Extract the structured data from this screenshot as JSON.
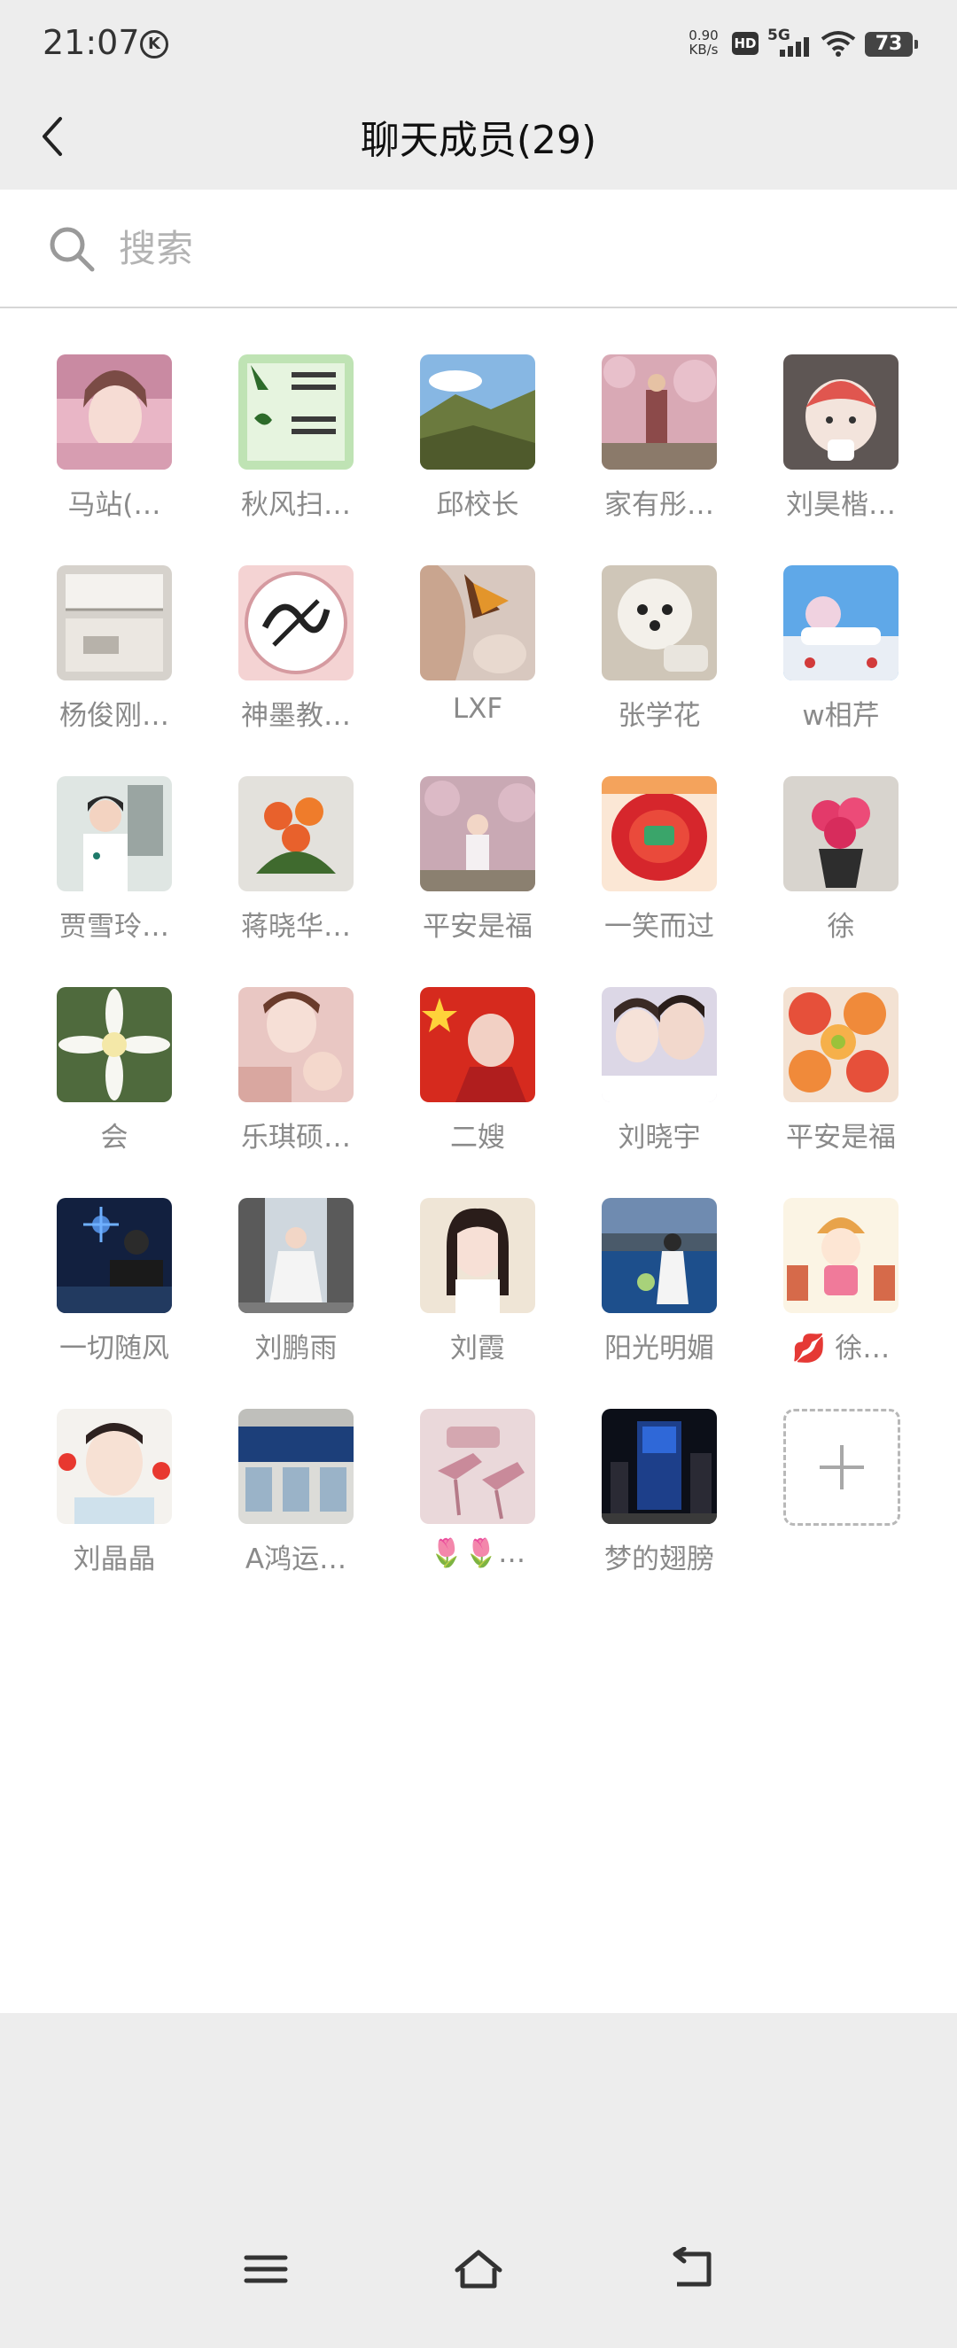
{
  "status": {
    "time": "21:07",
    "k_label": "K",
    "speed_value": "0.90",
    "speed_unit": "KB/s",
    "hd_label": "HD",
    "network_label": "5G",
    "battery": "73"
  },
  "header": {
    "title": "聊天成员(29)",
    "back_icon": "chevron-left-icon"
  },
  "search": {
    "placeholder": "搜索",
    "value": ""
  },
  "members": [
    {
      "name": "马站(…"
    },
    {
      "name": "秋风扫…"
    },
    {
      "name": "邱校长"
    },
    {
      "name": "家有彤…"
    },
    {
      "name": "刘昊楷…"
    },
    {
      "name": "杨俊刚…"
    },
    {
      "name": "神墨教…"
    },
    {
      "name": "LXF"
    },
    {
      "name": "张学花"
    },
    {
      "name": "w相芹"
    },
    {
      "name": "贾雪玲…"
    },
    {
      "name": "蒋晓华…"
    },
    {
      "name": "平安是福"
    },
    {
      "name": "一笑而过"
    },
    {
      "name": "徐"
    },
    {
      "name": "会"
    },
    {
      "name": "乐琪硕…"
    },
    {
      "name": "二嫂"
    },
    {
      "name": "刘晓宇"
    },
    {
      "name": "平安是福"
    },
    {
      "name": "一切随风"
    },
    {
      "name": "刘鹏雨"
    },
    {
      "name": "刘霞"
    },
    {
      "name": "阳光明媚"
    },
    {
      "name": "💋 徐…"
    },
    {
      "name": "刘晶晶"
    },
    {
      "name": "A鸿运…"
    },
    {
      "name": "🌷🌷…"
    },
    {
      "name": "梦的翅膀"
    }
  ],
  "add_member": {
    "icon": "plus-icon"
  },
  "nav": {
    "menu_icon": "menu-icon",
    "home_icon": "home-icon",
    "back_icon": "back-arrow-icon"
  }
}
